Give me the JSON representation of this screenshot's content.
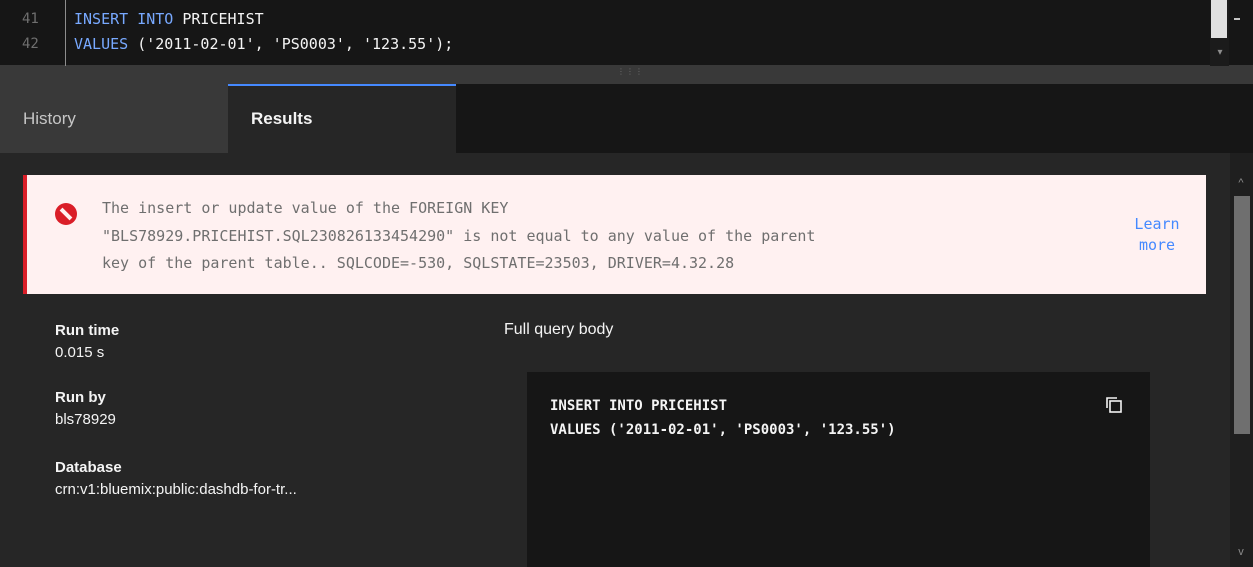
{
  "editor": {
    "lines": [
      {
        "number": "41",
        "keyword": "INSERT INTO",
        "rest": " PRICEHIST"
      },
      {
        "number": "42",
        "keyword": "VALUES",
        "rest": " ('2011-02-01', 'PS0003', '123.55');"
      }
    ],
    "scroll_down_icon": "▾"
  },
  "splitter": {
    "grip": "⋮⋮⋮"
  },
  "tabs": [
    {
      "label": "History",
      "active": false
    },
    {
      "label": "Results",
      "active": true
    }
  ],
  "error": {
    "lines": [
      "The insert or update value of the FOREIGN KEY",
      "\"BLS78929.PRICEHIST.SQL230826133454290\" is not equal to any value of the parent",
      "key of the parent table.. SQLCODE=-530, SQLSTATE=23503, DRIVER=4.32.28"
    ],
    "link_line1": "Learn",
    "link_line2": "more",
    "color": "#da1e28"
  },
  "meta": {
    "run_time_label": "Run time",
    "run_time_value": "0.015 s",
    "run_by_label": "Run by",
    "run_by_value": "bls78929",
    "database_label": "Database",
    "database_value": "crn:v1:bluemix:public:dashdb-for-tr..."
  },
  "query": {
    "label": "Full query body",
    "lines": [
      "INSERT INTO PRICEHIST",
      "VALUES ('2011-02-01', 'PS0003', '123.55')"
    ],
    "copy_icon": "copy-icon"
  },
  "scrollbar": {
    "up_icon": "^",
    "down_icon": "v"
  }
}
